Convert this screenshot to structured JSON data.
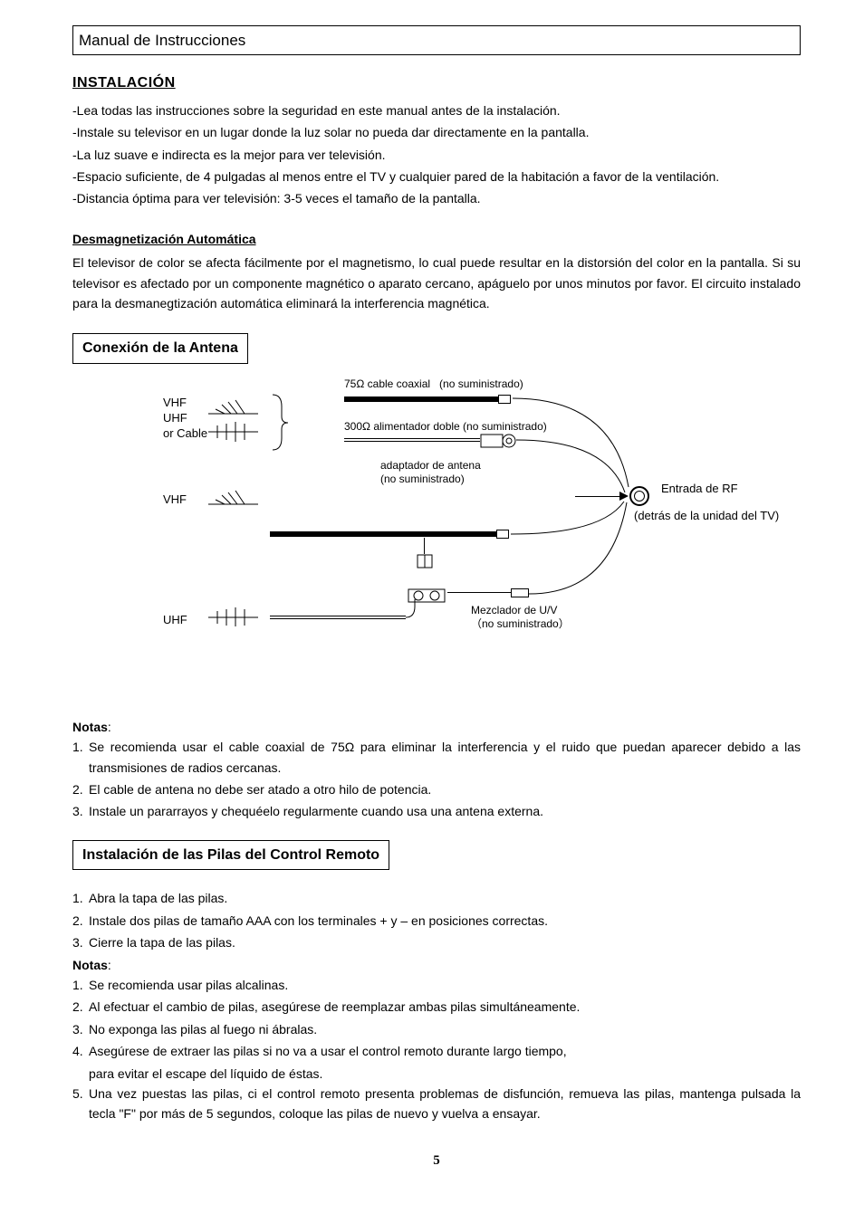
{
  "header": "Manual de Instrucciones",
  "install": {
    "title": "INSTALACIÓN",
    "items": [
      "-Lea todas las instrucciones sobre la seguridad en este manual antes de la instalación.",
      "-Instale su televisor en un lugar donde la luz solar no pueda dar directamente en la pantalla.",
      "-La luz suave e indirecta es la mejor para ver televisión.",
      "-Espacio suficiente, de 4 pulgadas al menos entre el TV y cualquier pared de la habitación a favor de la ventilación.",
      "-Distancia óptima para ver televisión: 3-5 veces el tamaño de la pantalla."
    ]
  },
  "demag": {
    "title": "Desmagnetización Automática",
    "body": "El televisor de color se afecta fácilmente por el magnetismo, lo cual puede resultar en la distorsión del color en la pantalla. Si su televisor es afectado por un componente magnético o aparato cercano, apáguelo por unos minutos por favor. El circuito instalado para la desmanegtización automática eliminará la interferencia magnética."
  },
  "antenna_section": {
    "title": "Conexión de la Antena",
    "diagram": {
      "vhf_uhf_cable": "VHF\nUHF\nor Cable",
      "vhf": "VHF",
      "uhf": "UHF",
      "coax75": "75Ω cable coaxial",
      "no_sumin": "(no suministrado)",
      "feeder300": "300Ω alimentador doble (no suministrado)",
      "adapter": "adaptador de antena",
      "adapter_note": "(no suministrado)",
      "rf_in": "Entrada de RF",
      "rf_note": "(detrás de la unidad del TV)",
      "mixer": "Mezclador de U/V",
      "mixer_note": "（no suministrado）"
    }
  },
  "antenna_notes": {
    "label": "Notas",
    "items": [
      "Se recomienda usar el cable coaxial de 75Ω para eliminar la interferencia y el ruido que puedan aparecer debido a las transmisiones de radios cercanas.",
      "El cable de antena no debe ser atado a otro hilo de potencia.",
      "Instale un pararrayos y chequéelo regularmente cuando usa una antena externa."
    ]
  },
  "remote": {
    "title": "Instalación de las Pilas del Control Remoto",
    "steps": [
      "Abra la tapa de las pilas.",
      "Instale dos pilas de tamaño AAA con los terminales + y – en posiciones correctas.",
      "Cierre la tapa de las pilas."
    ],
    "notes_label": "Notas",
    "notes": [
      "Se recomienda usar pilas alcalinas.",
      "Al efectuar el cambio de pilas, asegúrese de reemplazar ambas pilas simultáneamente.",
      "No exponga las pilas al fuego ni ábralas.",
      "Asegúrese de extraer las pilas si no va a usar el control remoto durante largo tiempo,",
      "Una vez puestas las pilas, ci el control remoto presenta problemas de disfunción, remueva las pilas, mantenga pulsada la tecla \"F\" por más de 5 segundos, coloque las pilas de nuevo y vuelva a ensayar."
    ],
    "note4_cont": "para evitar el escape del líquido de éstas."
  },
  "page_number": "5"
}
